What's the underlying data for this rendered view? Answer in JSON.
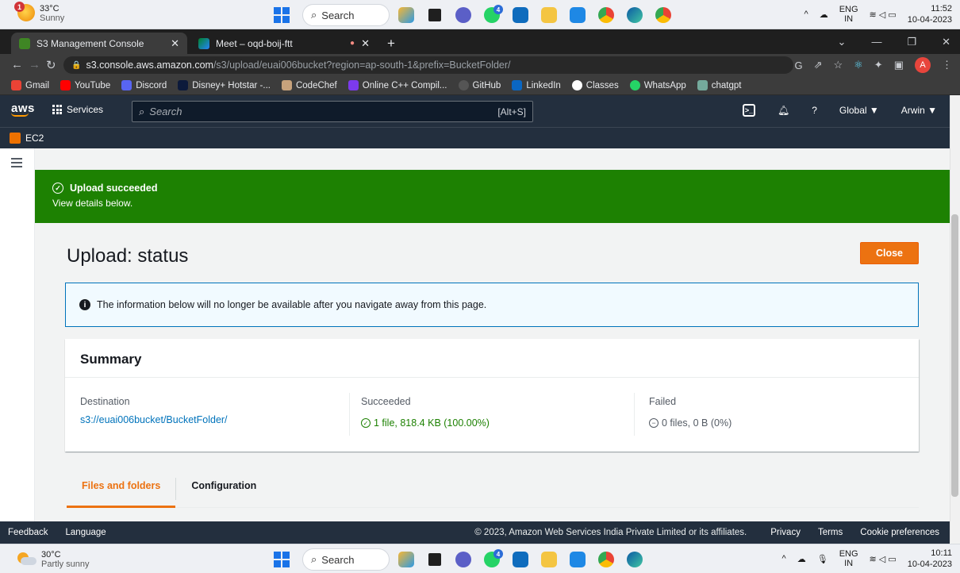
{
  "taskbar_top": {
    "weather_badge": "1",
    "temp": "33°C",
    "condition": "Sunny",
    "search_label": "Search",
    "app_badge": "4",
    "lang1": "ENG",
    "lang2": "IN",
    "time": "11:52",
    "date": "10-04-2023"
  },
  "browser": {
    "tabs": [
      {
        "title": "S3 Management Console",
        "close": "✕"
      },
      {
        "title": "Meet – oqd-boij-ftt",
        "close": "✕"
      }
    ],
    "new_tab": "+",
    "url_host": "s3.console.aws.amazon.com",
    "url_path": "/s3/upload/euai006bucket?region=ap-south-1&prefix=BucketFolder/",
    "profile_initial": "A",
    "bookmarks": [
      "Gmail",
      "YouTube",
      "Discord",
      "Disney+ Hotstar -...",
      "CodeChef",
      "Online C++ Compil...",
      "GitHub",
      "LinkedIn",
      "Classes",
      "WhatsApp",
      "chatgpt"
    ]
  },
  "aws": {
    "logo": "aws",
    "services_label": "Services",
    "search_placeholder": "Search",
    "search_shortcut": "[Alt+S]",
    "region": "Global ▼",
    "user": "Arwin ▼",
    "sub_service": "EC2"
  },
  "flash": {
    "title": "Upload succeeded",
    "message": "View details below."
  },
  "page": {
    "title": "Upload: status",
    "close_label": "Close",
    "info_text": "The information below will no longer be available after you navigate away from this page.",
    "summary_title": "Summary",
    "destination_label": "Destination",
    "destination_value": "s3://euai006bucket/BucketFolder/",
    "succeeded_label": "Succeeded",
    "succeeded_value": "1 file, 818.4 KB (100.00%)",
    "failed_label": "Failed",
    "failed_value": "0 files, 0 B (0%)",
    "tabs": [
      "Files and folders",
      "Configuration"
    ]
  },
  "footer": {
    "feedback": "Feedback",
    "language": "Language",
    "copyright": "© 2023, Amazon Web Services India Private Limited or its affiliates.",
    "privacy": "Privacy",
    "terms": "Terms",
    "cookies": "Cookie preferences"
  },
  "taskbar_bottom": {
    "temp": "30°C",
    "condition": "Partly sunny",
    "search_label": "Search",
    "app_badge": "4",
    "lang1": "ENG",
    "lang2": "IN",
    "time": "10:11",
    "date": "10-04-2023"
  },
  "colors": {
    "aws_nav": "#232f3e",
    "success": "#1d8102",
    "primary_button": "#ec7211",
    "link": "#0073bb"
  }
}
